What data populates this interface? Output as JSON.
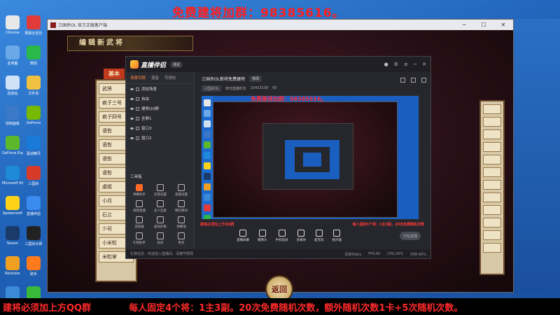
{
  "overlay": {
    "top_text": "免费建将加群：98385616。",
    "bottom_left": "建将必须加上方QQ群",
    "bottom_right": "每人固定4个将：1主3副。20次免费随机次数，额外随机次数1卡+5次随机次数。"
  },
  "desktop": {
    "col1": [
      {
        "label": "Chrome",
        "color": "#e8e8e8"
      },
      {
        "label": "此电脑",
        "color": "#6aa8e8"
      },
      {
        "label": "回收站",
        "color": "#cfe3f7"
      },
      {
        "label": "控制面板",
        "color": "#3a78c8"
      },
      {
        "label": "GeForce Experience",
        "color": "#5cb82a"
      },
      {
        "label": "Microsoft Edge",
        "color": "#1e8ad8"
      },
      {
        "label": "Apowersoft",
        "color": "#ffd21a"
      },
      {
        "label": "Steam",
        "color": "#1a3a6a"
      },
      {
        "label": "Rockstar",
        "color": "#f0a020"
      },
      {
        "label": "网络",
        "color": "#3a8ad8"
      }
    ],
    "col2": [
      {
        "label": "网易云音乐",
        "color": "#e03a3a"
      },
      {
        "label": "微信",
        "color": "#2ab84a"
      },
      {
        "label": "文件夹",
        "color": "#f0c040"
      },
      {
        "label": "GeForce",
        "color": "#76b900"
      },
      {
        "label": "驱动精灵",
        "color": "#1a7ad8"
      },
      {
        "label": "三国杀",
        "color": "#d83a2a"
      },
      {
        "label": "直播伴侣",
        "color": "#3a8af0"
      },
      {
        "label": "三国杀大师",
        "color": "#222222"
      },
      {
        "label": "助手",
        "color": "#ff7a1a"
      },
      {
        "label": "安全中心",
        "color": "#3ab83a"
      }
    ]
  },
  "game_window": {
    "title": "三国杀OL 官方正版客户端",
    "banner": "编辑新武将",
    "tab_basic": "基本",
    "list": [
      "武将",
      "疯子三号",
      "疯子四号",
      "语哲",
      "语哲",
      "语哲",
      "语哲",
      "虞姬",
      "小月",
      "石兰",
      "少司",
      "小米粒",
      "米粒掌"
    ],
    "return_label": "返回"
  },
  "stream_app": {
    "logo": "直播伴侣",
    "version": "测试",
    "tabs": [
      "场景切换",
      "混音",
      "可视化"
    ],
    "sources": [
      "添加场景",
      "自由",
      "建将QQ群",
      "全屏1",
      "窗口3",
      "窗口2"
    ],
    "tools_title": "工具箱",
    "tools": [
      "弹幕助手",
      "房管设置",
      "直播设置",
      "视频直播",
      "多人连麦",
      "精彩瞬间",
      "选购器",
      "虚拟形象",
      "弹幕墙",
      "礼物助手",
      "投屏",
      "更多"
    ],
    "status_left": "礼物信息：欢迎进入直播间，请遵守规则",
    "title_line": "三国杀OL新将免费建将",
    "title_btn": "修改",
    "info2": [
      "三国杀OL",
      "单日直播时长",
      "10423158",
      "60"
    ],
    "preview_text": "免费建将加群：98385616。",
    "caption_left": "建将必须加上方QQ群",
    "caption_right": "每人固定4个将：1主3副，20次免费随机次数",
    "controls": [
      "直播屏幕",
      "摄像头",
      "手机投屏",
      "多媒体",
      "麦克风",
      "扬声器"
    ],
    "live_button": "开始直播",
    "stats": [
      "码率0kb/s",
      "FPS:60",
      "CPU:20%",
      "内存:40%"
    ]
  }
}
